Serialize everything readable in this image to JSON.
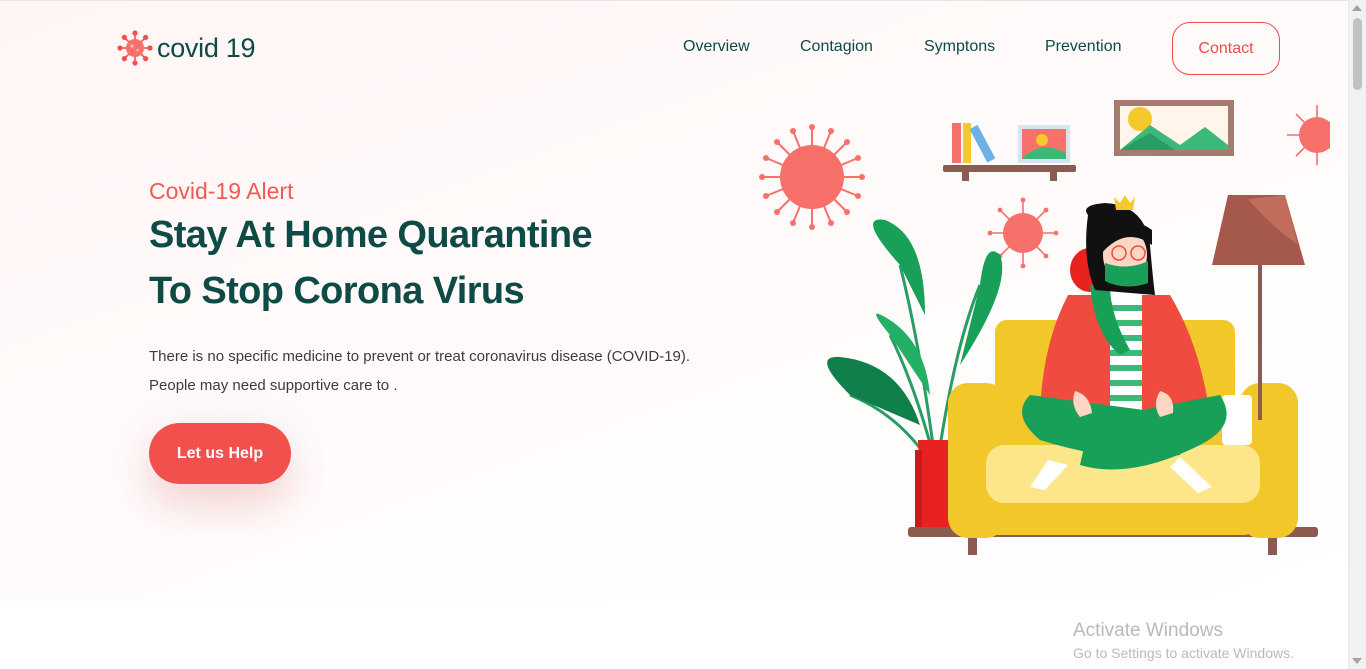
{
  "brand": {
    "name": "covid 19",
    "icon": "virus-icon",
    "accent": "#f2504d",
    "text_color": "#0e4a46"
  },
  "nav": {
    "items": [
      {
        "label": "Overview"
      },
      {
        "label": "Contagion"
      },
      {
        "label": "Symptons"
      },
      {
        "label": "Prevention"
      }
    ],
    "contact_label": "Contact"
  },
  "hero": {
    "alert": "Covid-19 Alert",
    "title_line1": "Stay At Home Quarantine",
    "title_line2": "To Stop Corona Virus",
    "desc_line1": "There is no specific medicine to prevent or treat coronavirus disease (COVID-19).",
    "desc_line2": "People may need supportive care to .",
    "cta_label": "Let us Help"
  },
  "watermark": {
    "title": "Activate Windows",
    "subtitle": "Go to Settings to activate Windows."
  }
}
